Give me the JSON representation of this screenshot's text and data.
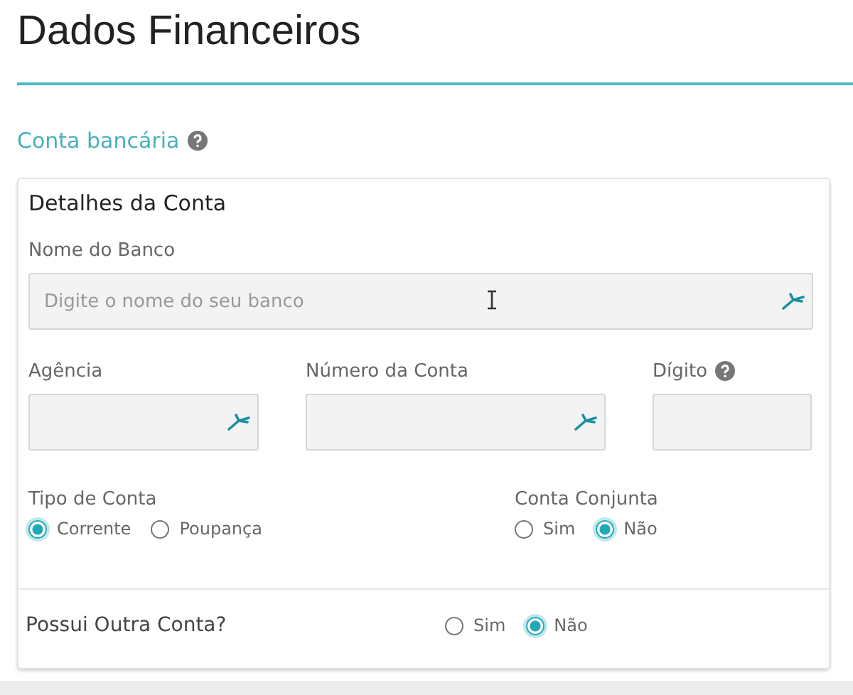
{
  "title": "Dados Financeiros",
  "section": {
    "title": "Conta bancária",
    "help": true
  },
  "card": {
    "title": "Detalhes da Conta",
    "field_rows": [
      [
        {
          "label": "Nome do Banco",
          "placeholder": "Digite o nome do seu banco",
          "icon": true,
          "help": false,
          "cursor": true
        }
      ],
      [
        {
          "label": "Agência",
          "icon": true,
          "help": false,
          "cursor": false
        },
        {
          "label": "Número da Conta",
          "icon": true,
          "help": false,
          "cursor": false
        },
        {
          "label": "Dígito",
          "icon": false,
          "help": true,
          "cursor": false
        }
      ]
    ],
    "radio_groups": [
      {
        "label": "Tipo de Conta",
        "options": [
          {
            "label": "Corrente",
            "selected": true
          },
          {
            "label": "Poupança",
            "selected": false
          }
        ]
      },
      {
        "label": "Conta Conjunta",
        "options": [
          {
            "label": "Sim",
            "selected": false
          },
          {
            "label": "Não",
            "selected": true
          }
        ]
      }
    ],
    "other_account": {
      "label": "Possui Outra Conta?",
      "options": [
        {
          "label": "Sim",
          "selected": false
        },
        {
          "label": "Não",
          "selected": true
        }
      ]
    }
  }
}
